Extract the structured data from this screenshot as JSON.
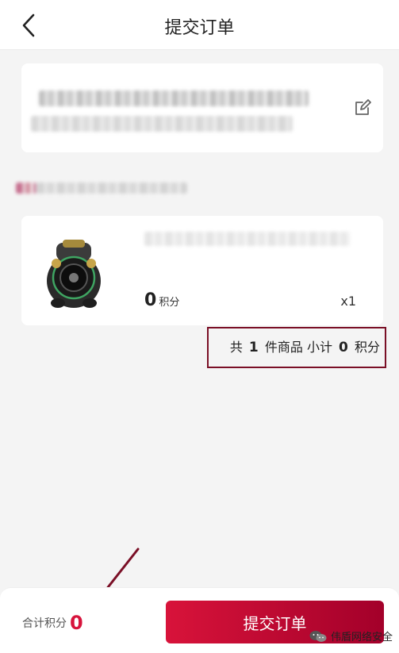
{
  "header": {
    "title": "提交订单",
    "back_icon": "chevron-left-icon"
  },
  "address": {
    "edit_icon": "edit-icon"
  },
  "goods": {
    "points_value": "0",
    "points_unit": "积分",
    "quantity": "x1"
  },
  "subtotal": {
    "prefix": "共",
    "count": "1",
    "middle": "件商品 小计",
    "points": "0",
    "unit": "积分"
  },
  "footer": {
    "total_label": "合计积分",
    "total_value": "0",
    "submit_label": "提交订单"
  },
  "watermark": {
    "text": "伟盾网络安全",
    "icon": "wechat-icon"
  },
  "colors": {
    "accent": "#d7143c",
    "highlight_border": "#7a0f26"
  }
}
